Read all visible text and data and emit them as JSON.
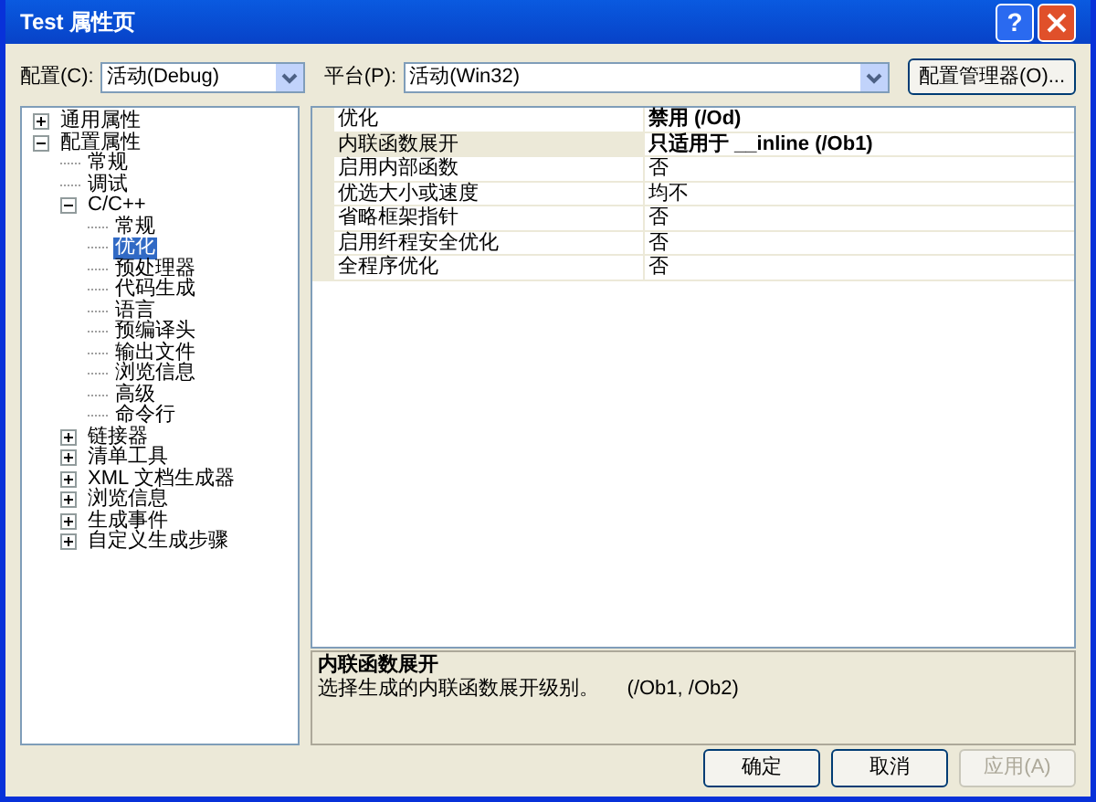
{
  "window": {
    "title": "Test 属性页",
    "help_button": "?"
  },
  "toolbar": {
    "config_label": "配置(C):",
    "config_value": "活动(Debug)",
    "platform_label": "平台(P):",
    "platform_value": "活动(Win32)",
    "manager_button": "配置管理器(O)..."
  },
  "tree": [
    {
      "label": "通用属性",
      "expanded": false,
      "selected": false
    },
    {
      "label": "配置属性",
      "expanded": true,
      "selected": false,
      "children": [
        {
          "label": "常规",
          "selected": false
        },
        {
          "label": "调试",
          "selected": false
        },
        {
          "label": "C/C++",
          "expanded": true,
          "selected": false,
          "children": [
            {
              "label": "常规",
              "selected": false
            },
            {
              "label": "优化",
              "selected": true
            },
            {
              "label": "预处理器",
              "selected": false
            },
            {
              "label": "代码生成",
              "selected": false
            },
            {
              "label": "语言",
              "selected": false
            },
            {
              "label": "预编译头",
              "selected": false
            },
            {
              "label": "输出文件",
              "selected": false
            },
            {
              "label": "浏览信息",
              "selected": false
            },
            {
              "label": "高级",
              "selected": false
            },
            {
              "label": "命令行",
              "selected": false
            }
          ]
        },
        {
          "label": "链接器",
          "expanded": false,
          "selected": false
        },
        {
          "label": "清单工具",
          "expanded": false,
          "selected": false
        },
        {
          "label": "XML 文档生成器",
          "expanded": false,
          "selected": false
        },
        {
          "label": "浏览信息",
          "expanded": false,
          "selected": false
        },
        {
          "label": "生成事件",
          "expanded": false,
          "selected": false
        },
        {
          "label": "自定义生成步骤",
          "expanded": false,
          "selected": false
        }
      ]
    }
  ],
  "properties": [
    {
      "name": "优化",
      "value": "禁用 (/Od)",
      "modified": true,
      "selected": false
    },
    {
      "name": "内联函数展开",
      "value": "只适用于 __inline (/Ob1)",
      "modified": true,
      "selected": true
    },
    {
      "name": "启用内部函数",
      "value": "否",
      "modified": false,
      "selected": false
    },
    {
      "name": "优选大小或速度",
      "value": "均不",
      "modified": false,
      "selected": false
    },
    {
      "name": "省略框架指针",
      "value": "否",
      "modified": false,
      "selected": false
    },
    {
      "name": "启用纤程安全优化",
      "value": "否",
      "modified": false,
      "selected": false
    },
    {
      "name": "全程序优化",
      "value": "否",
      "modified": false,
      "selected": false
    }
  ],
  "description": {
    "title": "内联函数展开",
    "text": "选择生成的内联函数展开级别。     (/Ob1, /Ob2)"
  },
  "buttons": [
    {
      "label": "确定",
      "disabled": false
    },
    {
      "label": "取消",
      "disabled": false
    },
    {
      "label": "应用(A)",
      "disabled": true
    }
  ]
}
